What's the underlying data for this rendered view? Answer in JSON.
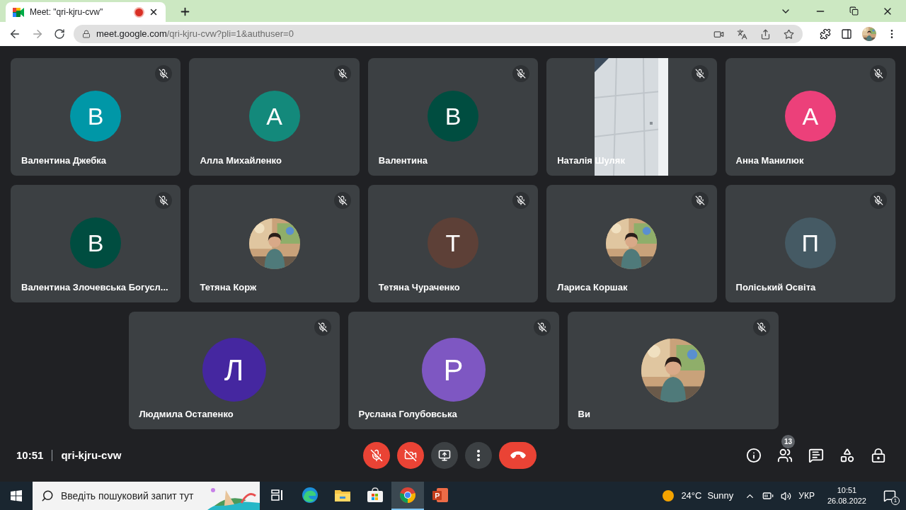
{
  "browser": {
    "tab": {
      "title": "Meet: \"qri-kjru-cvw\"",
      "recording": true
    },
    "url": {
      "host": "meet.google.com",
      "path": "/qri-kjru-cvw?pli=1&authuser=0"
    }
  },
  "tiles": [
    {
      "name": "Валентина Джебка",
      "kind": "avatar",
      "letter": "В",
      "color": "#0097a7",
      "muted": true
    },
    {
      "name": "Алла Михайленко",
      "kind": "avatar",
      "letter": "А",
      "color": "#13897b",
      "muted": true
    },
    {
      "name": "Валентина",
      "kind": "avatar",
      "letter": "В",
      "color": "#004d40",
      "muted": true
    },
    {
      "name": "Наталія Шуляк",
      "kind": "video",
      "muted": true
    },
    {
      "name": "Анна Манилюк",
      "kind": "avatar",
      "letter": "А",
      "color": "#ec407a",
      "muted": true
    },
    {
      "name": "Валентина Злочевська Богусл...",
      "kind": "avatar",
      "letter": "В",
      "color": "#004d40",
      "muted": true
    },
    {
      "name": "Тетяна Корж",
      "muted": true
    },
    {
      "name": "Тетяна Чураченко",
      "kind": "avatar",
      "letter": "Т",
      "color": "#5d4037",
      "muted": true
    },
    {
      "name": "Лариса Коршак",
      "muted": true
    },
    {
      "name": "Поліський Освіта",
      "kind": "avatar",
      "letter": "П",
      "color": "#455a64",
      "muted": true
    },
    {
      "name": "Людмила Остапенко",
      "kind": "avatar",
      "letter": "Л",
      "color": "#4527a0",
      "muted": true
    },
    {
      "name": "Руслана Голубовська",
      "kind": "avatar",
      "letter": "Р",
      "color": "#7e57c2",
      "muted": true
    },
    {
      "name": "Ви",
      "muted": true
    }
  ],
  "meeting": {
    "time": "10:51",
    "code": "qri-kjru-cvw",
    "participants_count": "13"
  },
  "controls": [
    {
      "kind": "mic",
      "off": true
    },
    {
      "kind": "camera",
      "off": true
    },
    {
      "kind": "present",
      "off": false
    },
    {
      "kind": "more",
      "off": false
    },
    {
      "kind": "leave"
    }
  ],
  "taskbar": {
    "search": {
      "placeholder": "Введіть пошуковий запит тут"
    },
    "apps": [
      {
        "kind": "taskview",
        "selected": false
      },
      {
        "kind": "edge",
        "selected": false
      },
      {
        "kind": "explorer",
        "selected": false
      },
      {
        "kind": "store",
        "selected": false
      },
      {
        "kind": "chrome",
        "selected": true
      },
      {
        "kind": "powerpoint",
        "selected": false
      }
    ],
    "temperature": "24°C",
    "weather": "Sunny",
    "language": "УКР",
    "time": "10:51",
    "date": "26.08.2022",
    "notifications": "1"
  }
}
